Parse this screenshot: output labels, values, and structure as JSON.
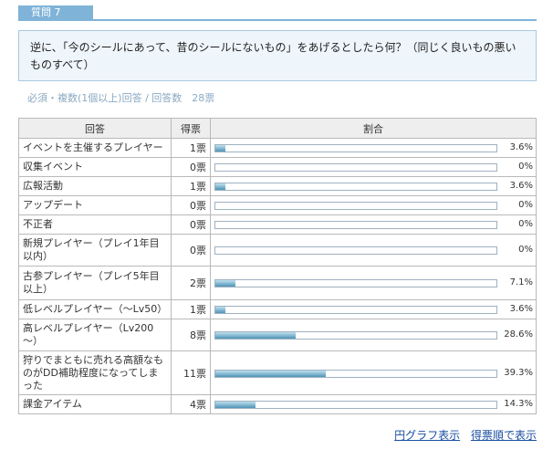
{
  "tab_label": "質問 7",
  "question": "逆に、「今のシールにあって、昔のシールにないもの」をあげるとしたら何？（同じく良いもの悪いものすべて）",
  "meta": "必須・複数(1個以上)回答 / 回答数　28票",
  "table": {
    "headers": {
      "answer": "回答",
      "count": "得票",
      "ratio": "割合"
    },
    "rows": [
      {
        "answer": "イベントを主催するプレイヤー",
        "count": "1票",
        "percent": "3.6%",
        "value": 3.6
      },
      {
        "answer": "収集イベント",
        "count": "0票",
        "percent": "0%",
        "value": 0
      },
      {
        "answer": "広報活動",
        "count": "1票",
        "percent": "3.6%",
        "value": 3.6
      },
      {
        "answer": "アップデート",
        "count": "0票",
        "percent": "0%",
        "value": 0
      },
      {
        "answer": "不正者",
        "count": "0票",
        "percent": "0%",
        "value": 0
      },
      {
        "answer": "新規プレイヤー（プレイ1年目以内）",
        "count": "0票",
        "percent": "0%",
        "value": 0
      },
      {
        "answer": "古参プレイヤー（プレイ5年目以上）",
        "count": "2票",
        "percent": "7.1%",
        "value": 7.1
      },
      {
        "answer": "低レベルプレイヤー（～Lv50）",
        "count": "1票",
        "percent": "3.6%",
        "value": 3.6
      },
      {
        "answer": "高レベルプレイヤー（Lv200～）",
        "count": "8票",
        "percent": "28.6%",
        "value": 28.6
      },
      {
        "answer": "狩りでまともに売れる高額なものがDD補助程度になってしまった",
        "count": "11票",
        "percent": "39.3%",
        "value": 39.3
      },
      {
        "answer": "課金アイテム",
        "count": "4票",
        "percent": "14.3%",
        "value": 14.3
      }
    ]
  },
  "links": {
    "pie": "円グラフ表示",
    "sort": "得票順で表示"
  }
}
